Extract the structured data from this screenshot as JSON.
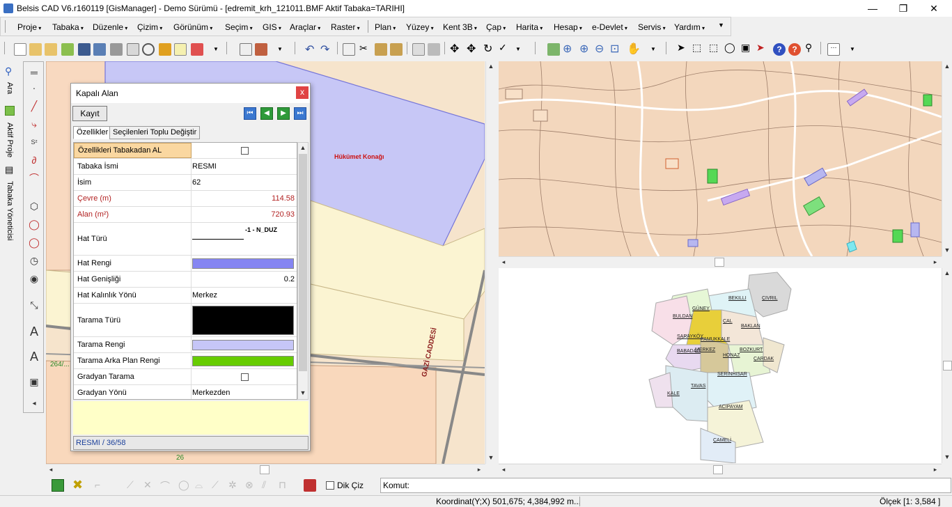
{
  "window": {
    "title": "Belsis CAD V6.r160119 [GisManager] - Demo Sürümü - [edremit_krh_121011.BMF  Aktif Tabaka=TARIHI]",
    "minimize": "—",
    "maximize": "❐",
    "close": "✕"
  },
  "menu": [
    "Proje",
    "Tabaka",
    "Düzenle",
    "Çizim",
    "Görünüm",
    "Seçim",
    "GIS",
    "Araçlar",
    "Raster",
    "Plan",
    "Yüzey",
    "Kent 3B",
    "Çap",
    "Harita",
    "Hesap",
    "e-Devlet",
    "Servis",
    "Yardım"
  ],
  "left_tabs": [
    "Ara",
    "Aktif Proje",
    "Tabaka Yöneticisi"
  ],
  "map": {
    "building_label": "Hükümet Konağı",
    "street_label": "GAZİ CADDESİ",
    "parcel_label_1": "264/...",
    "parcel_label_2": "26"
  },
  "regions": [
    "BEKILLI",
    "ÇIVRIL",
    "GÜNEY",
    "BULDAN",
    "ÇAL",
    "BAKLAN",
    "SARAYKÖY",
    "PAMUKKALE",
    "BABADAĞ",
    "MERKEZ",
    "HONAZ",
    "BOZKURT",
    "ÇARDAK",
    "SERINHISAR",
    "TAVAS",
    "KALE",
    "ACIPAYAM",
    "ÇAMELİ"
  ],
  "dialog": {
    "title": "Kapalı Alan",
    "close": "x",
    "save_button": "Kayıt",
    "tabs": [
      "Özellikler",
      "Seçilenleri Toplu Değiştir"
    ],
    "properties": [
      {
        "key": "Özellikleri Tabakadan AL",
        "type": "checkbox",
        "checked": false
      },
      {
        "key": "Tabaka İsmi",
        "value": "RESMI"
      },
      {
        "key": "İsim",
        "value": "62"
      },
      {
        "key": "Çevre (m)",
        "value": "114.58"
      },
      {
        "key": "Alan (m²)",
        "value": "720.93"
      },
      {
        "key": "Hat Türü",
        "value": "-1 - N_DUZ"
      },
      {
        "key": "Hat Rengi",
        "swatch": "#8585f2"
      },
      {
        "key": "Hat Genişliği",
        "value": "0.2"
      },
      {
        "key": "Hat Kalınlık Yönü",
        "value": "Merkez"
      },
      {
        "key": "Tarama Türü",
        "swatch": "#000000"
      },
      {
        "key": "Tarama Rengi",
        "swatch": "#c6c6f7"
      },
      {
        "key": "Tarama Arka Plan Rengi",
        "swatch": "#66cc00"
      },
      {
        "key": "Gradyan Tarama",
        "type": "checkbox",
        "checked": false
      },
      {
        "key": "Gradyan Yönü",
        "value": "Merkezden"
      }
    ],
    "status": "RESMI / 36/58"
  },
  "bottom": {
    "dik_ciz": "Dik Çiz",
    "komut": "Komut:"
  },
  "statusbar": {
    "coordinate": "Koordinat(Y;X)  501,675; 4,384,992 m...",
    "scale": "Ölçek [1: 3,584 ]"
  }
}
